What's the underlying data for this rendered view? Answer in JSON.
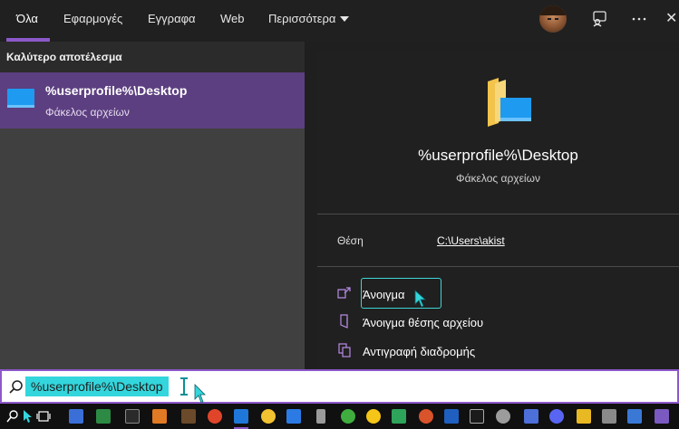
{
  "tabs": [
    {
      "label": "Όλα",
      "active": true
    },
    {
      "label": "Εφαρμογές"
    },
    {
      "label": "Εγγραφα"
    },
    {
      "label": "Web"
    },
    {
      "label": "Περισσότερα"
    }
  ],
  "best_match": {
    "header": "Καλύτερο αποτέλεσμα",
    "title": "%userprofile%\\Desktop",
    "subtitle": "Φάκελος αρχείων"
  },
  "preview": {
    "title": "%userprofile%\\Desktop",
    "subtitle": "Φάκελος αρχείων",
    "location_label": "Θέση",
    "location_value": "C:\\Users\\akist",
    "actions": [
      {
        "label": "Άνοιγμα",
        "icon": "open-icon"
      },
      {
        "label": "Άνοιγμα θέσης αρχείου",
        "icon": "file-location-icon"
      },
      {
        "label": "Αντιγραφή διαδρομής",
        "icon": "copy-path-icon"
      }
    ]
  },
  "search": {
    "value": "%userprofile%\\Desktop"
  },
  "colors": {
    "accent": "#8c58c9",
    "selected_row": "#5c3f80",
    "search_selection": "#33d6dc",
    "folder_yellow": "#f3c44c",
    "folder_blue": "#1e9bf0"
  }
}
